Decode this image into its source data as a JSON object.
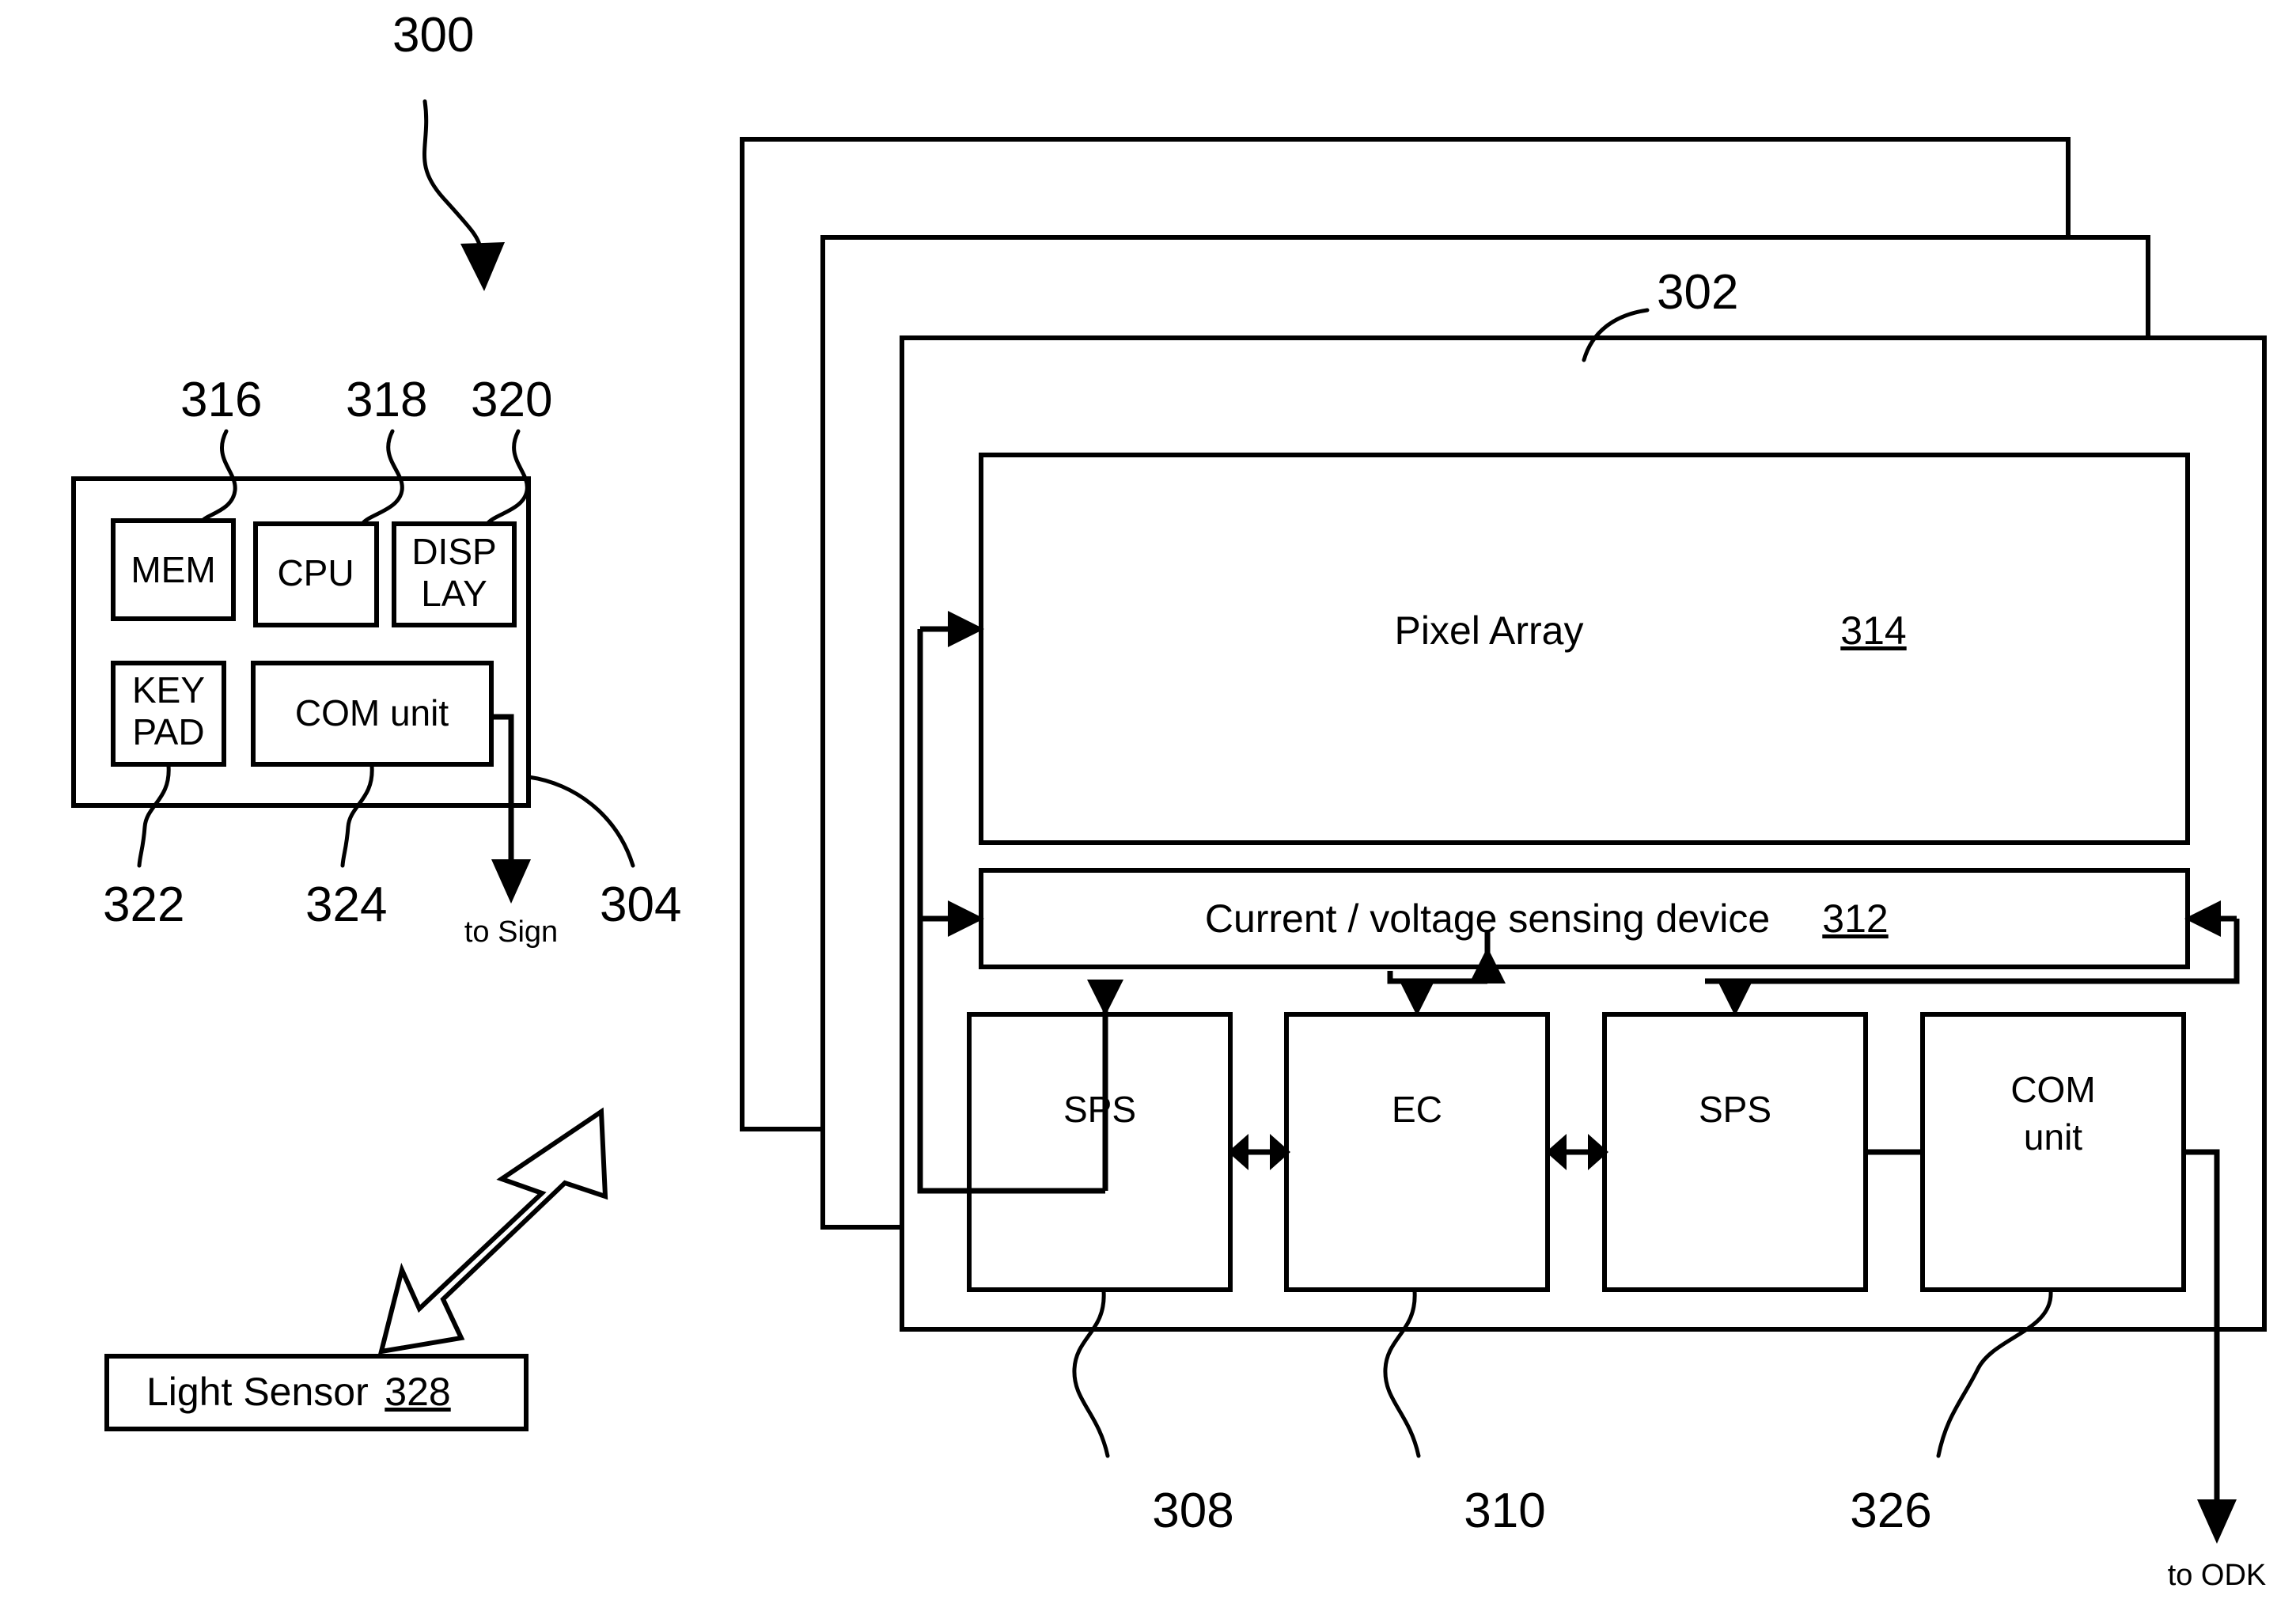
{
  "figure": {
    "reference_numerals": {
      "system": "300",
      "display_module": "302",
      "control_link": "304",
      "sps_left": "308",
      "ec": "310",
      "sensing_device": "312",
      "pixel_array": "314",
      "mem": "316",
      "cpu": "318",
      "display": "320",
      "keypad": "322",
      "com_unit_controller": "324",
      "com_unit_module": "326",
      "light_sensor": "328"
    },
    "controller_panel": {
      "blocks": [
        {
          "id": "mem",
          "label": "MEM",
          "ref": "316"
        },
        {
          "id": "cpu",
          "label": "CPU",
          "ref": "318"
        },
        {
          "id": "display",
          "label_line1": "DISP",
          "label_line2": "LAY",
          "ref": "320"
        },
        {
          "id": "keypad",
          "label_line1": "KEY",
          "label_line2": "PAD",
          "ref": "322"
        },
        {
          "id": "com-unit",
          "label": "COM unit",
          "ref": "324"
        }
      ],
      "output_label": "to Sign",
      "link_ref": "304"
    },
    "light_sensor": {
      "label": "Light Sensor",
      "ref": "328"
    },
    "display_module": {
      "ref": "302",
      "pixel_array": {
        "label": "Pixel Array",
        "ref": "314"
      },
      "sensing_device": {
        "label": "Current / voltage sensing device",
        "ref": "312"
      },
      "bottom_blocks": [
        {
          "id": "sps-left",
          "label": "SPS",
          "ref": "308"
        },
        {
          "id": "ec",
          "label": "EC",
          "ref": "310"
        },
        {
          "id": "sps-right",
          "label": "SPS",
          "ref": ""
        },
        {
          "id": "com-unit",
          "label_line1": "COM",
          "label_line2": "unit",
          "ref": "326"
        }
      ],
      "output_label": "to ODK"
    }
  }
}
